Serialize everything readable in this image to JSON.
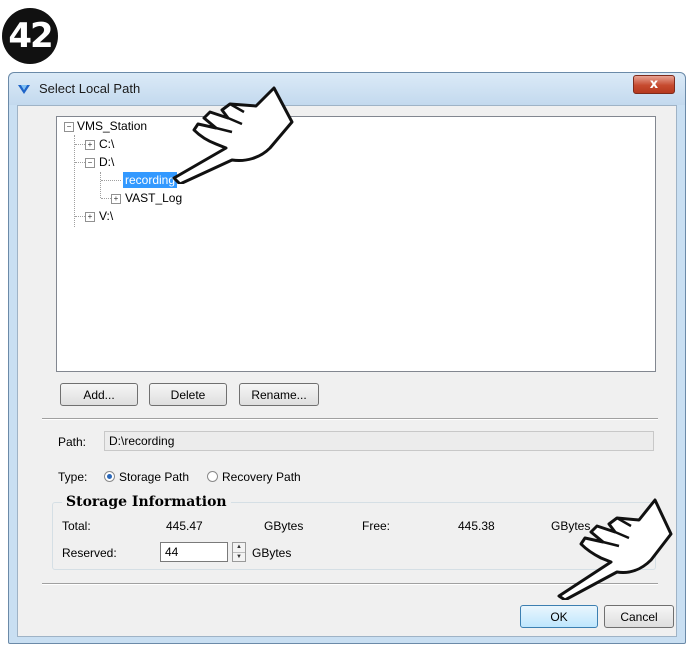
{
  "step_number": "42",
  "window": {
    "title": "Select Local Path",
    "close_label": "x"
  },
  "tree": {
    "root": "VMS_Station",
    "drives": [
      "C:\\",
      "D:\\",
      "V:\\"
    ],
    "d_children": [
      "recording",
      "VAST_Log"
    ],
    "selected": "recording"
  },
  "buttons": {
    "add": "Add...",
    "delete": "Delete",
    "rename": "Rename...",
    "ok": "OK",
    "cancel": "Cancel"
  },
  "path": {
    "label": "Path:",
    "value": "D:\\recording"
  },
  "type": {
    "label": "Type:",
    "storage": "Storage Path",
    "recovery": "Recovery Path",
    "selected": "Storage Path"
  },
  "storage": {
    "title": "Storage Information",
    "total_label": "Total:",
    "total_value": "445.47",
    "total_unit": "GBytes",
    "free_label": "Free:",
    "free_value": "445.38",
    "free_unit": "GBytes",
    "reserved_label": "Reserved:",
    "reserved_value": "44",
    "reserved_unit": "GBytes"
  },
  "icons": {
    "window": "app-logo-icon",
    "pointer": "pointing-hand-icon"
  }
}
